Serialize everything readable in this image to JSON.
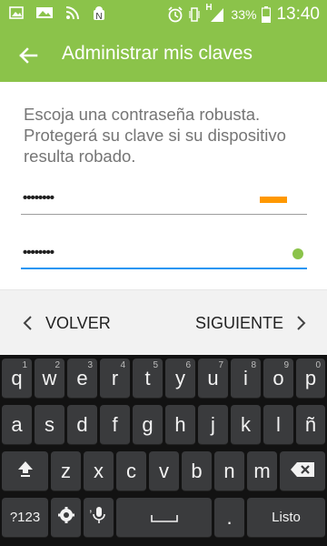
{
  "status_bar": {
    "battery_text": "33%",
    "time": "13:40",
    "signal_type": "H",
    "icons": [
      "image-icon",
      "photo-icon",
      "rss-icon",
      "android-icon",
      "alarm-icon",
      "vibrate-icon",
      "signal-icon",
      "battery-icon"
    ],
    "colors": {
      "background": "#8bc34a",
      "foreground": "#ffffff"
    }
  },
  "action_bar": {
    "title": "Administrar mis claves",
    "back_icon": "arrow-back-icon",
    "color": "#8bc34a"
  },
  "content": {
    "description": "Escoja una contraseña robusta. Protegerá su clave si su dispositivo resulta robado.",
    "password_field": {
      "value": "••••••••",
      "strength_color": "#ff9800"
    },
    "confirm_field": {
      "value": "••••••••",
      "match_color": "#8bc34a",
      "focused": true
    }
  },
  "navigation": {
    "back_label": "VOLVER",
    "next_label": "SIGUIENTE"
  },
  "keyboard": {
    "row1": [
      "q",
      "w",
      "e",
      "r",
      "t",
      "y",
      "u",
      "i",
      "o",
      "p"
    ],
    "row1_hints": [
      "1",
      "2",
      "3",
      "4",
      "5",
      "6",
      "7",
      "8",
      "9",
      "0"
    ],
    "row2": [
      "a",
      "s",
      "d",
      "f",
      "g",
      "h",
      "j",
      "k",
      "l",
      "ñ"
    ],
    "row3": [
      "z",
      "x",
      "c",
      "v",
      "b",
      "n",
      "m"
    ],
    "symbols_label": "?123",
    "comma_label": ",",
    "period_label": ".",
    "enter_label": "Listo",
    "shift_icon": "shift-icon",
    "delete_icon": "backspace-icon",
    "settings_icon": "settings-icon",
    "mic_icon": "mic-icon",
    "space_icon": "space-icon"
  }
}
